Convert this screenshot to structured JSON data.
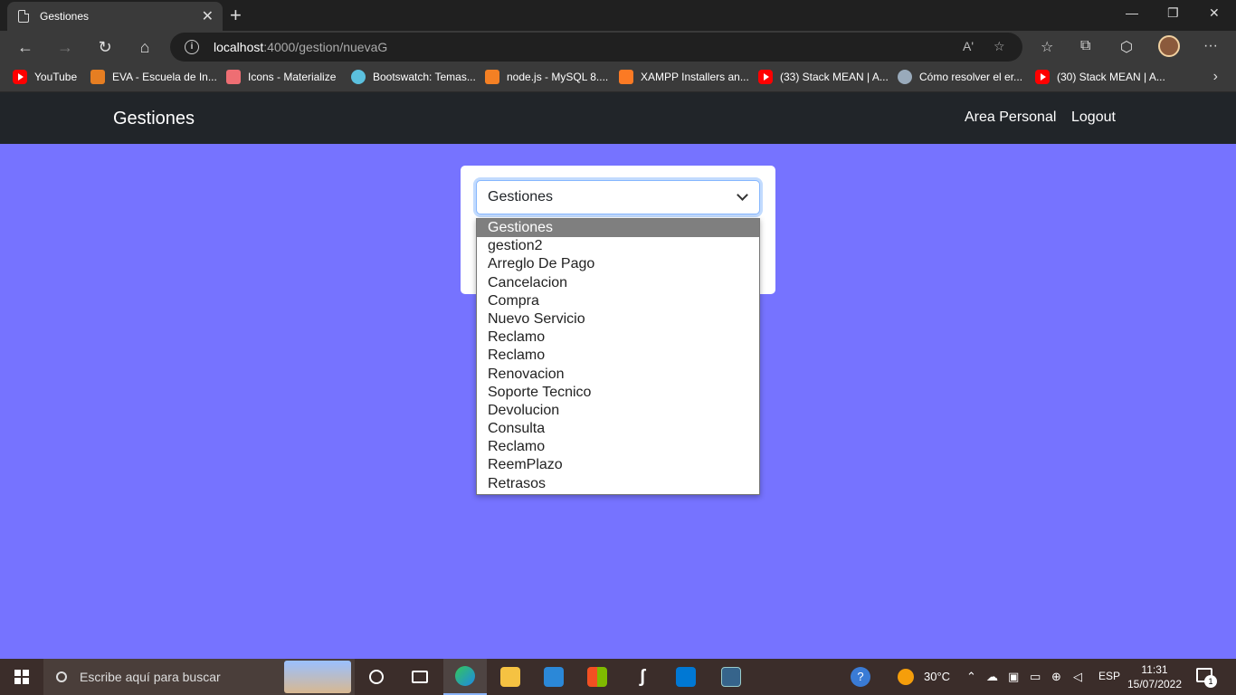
{
  "browser": {
    "tab_title": "Gestiones",
    "tab_close": "✕",
    "new_tab": "+",
    "url_host": "localhost",
    "url_rest": ":4000/gestion/nuevaG",
    "address_info_icon": "i",
    "read_aloud_icon": "Aʹ",
    "window_controls": [
      "—",
      "❐",
      "✕"
    ],
    "more_menu": "···"
  },
  "bookmarks": [
    {
      "label": "YouTube",
      "icon": "youtube-icon"
    },
    {
      "label": "EVA - Escuela de In...",
      "icon": "eva-icon"
    },
    {
      "label": "Icons - Materialize",
      "icon": "materialize-icon"
    },
    {
      "label": "Bootswatch: Temas...",
      "icon": "bootswatch-icon"
    },
    {
      "label": "node.js - MySQL 8....",
      "icon": "stackoverflow-icon"
    },
    {
      "label": "XAMPP Installers an...",
      "icon": "xampp-icon"
    },
    {
      "label": "(33) Stack MEAN | A...",
      "icon": "youtube-icon"
    },
    {
      "label": "Cómo resolver el er...",
      "icon": "gear-icon"
    },
    {
      "label": "(30) Stack MEAN | A...",
      "icon": "youtube-icon"
    }
  ],
  "navbar": {
    "brand": "Gestiones",
    "links": [
      "Area Personal",
      "Logout"
    ]
  },
  "form": {
    "selected_value": "Gestiones",
    "options": [
      "Gestiones",
      "gestion2",
      "Arreglo De Pago",
      "Cancelacion",
      "Compra",
      "Nuevo Servicio",
      "Reclamo",
      "Reclamo",
      "Renovacion",
      "Soporte Tecnico",
      "Devolucion",
      "Consulta",
      "Reclamo",
      "ReemPlazo",
      "Retrasos"
    ],
    "highlighted_index": 0
  },
  "taskbar": {
    "search_placeholder": "Escribe aquí para buscar",
    "temperature": "30°C",
    "language": "ESP",
    "time": "11:31",
    "date": "15/07/2022",
    "notification_count": "1"
  },
  "colors": {
    "page_background": "#7673ff",
    "navbar_background": "#212529",
    "option_highlight": "#7f7f7f"
  }
}
